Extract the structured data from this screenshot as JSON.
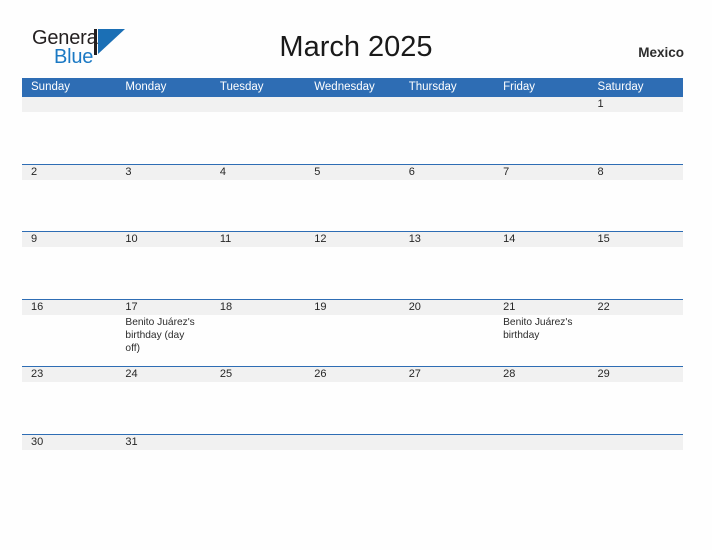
{
  "brand": {
    "name_part1": "General",
    "name_part2": "Blue",
    "logo_icon": "triangle-flag-icon",
    "accent_color": "#1b6fb5"
  },
  "header": {
    "title": "March 2025",
    "country": "Mexico"
  },
  "colors": {
    "header_blue": "#2e6db4",
    "row_divider_blue": "#2e6db4",
    "daynum_band_gray": "#f1f1f1",
    "text_dark": "#262626",
    "page_background": "#fefefe"
  },
  "calendar": {
    "month": "March",
    "year": "2025",
    "weekday_headers": [
      "Sunday",
      "Monday",
      "Tuesday",
      "Wednesday",
      "Thursday",
      "Friday",
      "Saturday"
    ],
    "weeks": [
      {
        "days": [
          {
            "number": "",
            "events": []
          },
          {
            "number": "",
            "events": []
          },
          {
            "number": "",
            "events": []
          },
          {
            "number": "",
            "events": []
          },
          {
            "number": "",
            "events": []
          },
          {
            "number": "",
            "events": []
          },
          {
            "number": "1",
            "events": []
          }
        ]
      },
      {
        "days": [
          {
            "number": "2",
            "events": []
          },
          {
            "number": "3",
            "events": []
          },
          {
            "number": "4",
            "events": []
          },
          {
            "number": "5",
            "events": []
          },
          {
            "number": "6",
            "events": []
          },
          {
            "number": "7",
            "events": []
          },
          {
            "number": "8",
            "events": []
          }
        ]
      },
      {
        "days": [
          {
            "number": "9",
            "events": []
          },
          {
            "number": "10",
            "events": []
          },
          {
            "number": "11",
            "events": []
          },
          {
            "number": "12",
            "events": []
          },
          {
            "number": "13",
            "events": []
          },
          {
            "number": "14",
            "events": []
          },
          {
            "number": "15",
            "events": []
          }
        ]
      },
      {
        "days": [
          {
            "number": "16",
            "events": []
          },
          {
            "number": "17",
            "events": [
              "Benito Juárez's birthday (day off)"
            ]
          },
          {
            "number": "18",
            "events": []
          },
          {
            "number": "19",
            "events": []
          },
          {
            "number": "20",
            "events": []
          },
          {
            "number": "21",
            "events": [
              "Benito Juárez's birthday"
            ]
          },
          {
            "number": "22",
            "events": []
          }
        ]
      },
      {
        "days": [
          {
            "number": "23",
            "events": []
          },
          {
            "number": "24",
            "events": []
          },
          {
            "number": "25",
            "events": []
          },
          {
            "number": "26",
            "events": []
          },
          {
            "number": "27",
            "events": []
          },
          {
            "number": "28",
            "events": []
          },
          {
            "number": "29",
            "events": []
          }
        ]
      },
      {
        "days": [
          {
            "number": "30",
            "events": []
          },
          {
            "number": "31",
            "events": []
          },
          {
            "number": "",
            "events": []
          },
          {
            "number": "",
            "events": []
          },
          {
            "number": "",
            "events": []
          },
          {
            "number": "",
            "events": []
          },
          {
            "number": "",
            "events": []
          }
        ]
      }
    ]
  }
}
